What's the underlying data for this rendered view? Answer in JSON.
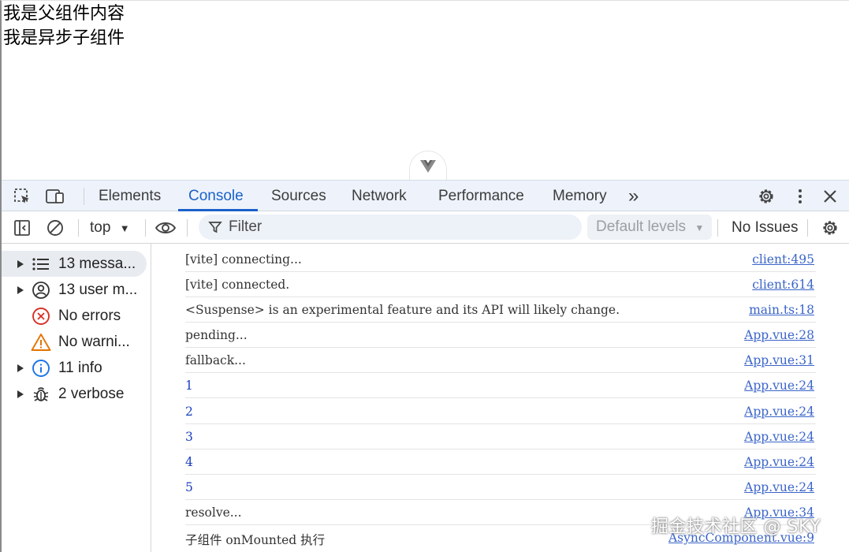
{
  "page": {
    "lines": [
      "我是父组件内容",
      "我是异步子组件"
    ]
  },
  "devtools": {
    "tabs": [
      "Elements",
      "Console",
      "Sources",
      "Network",
      "Performance",
      "Memory"
    ],
    "more_tabs": "»",
    "toolbar": {
      "context": "top",
      "filter_placeholder": "Filter",
      "levels": "Default levels",
      "issues": "No Issues"
    },
    "sidebar": [
      {
        "label": "13 messa...",
        "icon": "list-icon",
        "expandable": true,
        "selected": true
      },
      {
        "label": "13 user m...",
        "icon": "user-icon",
        "expandable": true,
        "selected": false
      },
      {
        "label": "No errors",
        "icon": "error-icon",
        "expandable": false,
        "selected": false
      },
      {
        "label": "No warni...",
        "icon": "warning-icon",
        "expandable": false,
        "selected": false
      },
      {
        "label": "11 info",
        "icon": "info-icon",
        "expandable": true,
        "selected": false
      },
      {
        "label": "2 verbose",
        "icon": "bug-icon",
        "expandable": true,
        "selected": false
      }
    ],
    "console_rows": [
      {
        "msg": "[vite] connecting...",
        "src": "client:495"
      },
      {
        "msg": "[vite] connected.",
        "src": "client:614"
      },
      {
        "msg": "<Suspense> is an experimental feature and its API will likely change.",
        "src": "main.ts:18"
      },
      {
        "msg": "pending...",
        "src": "App.vue:28"
      },
      {
        "msg": "fallback...",
        "src": "App.vue:31"
      },
      {
        "msg": "1",
        "src": "App.vue:24"
      },
      {
        "msg": "2",
        "src": "App.vue:24"
      },
      {
        "msg": "3",
        "src": "App.vue:24"
      },
      {
        "msg": "4",
        "src": "App.vue:24"
      },
      {
        "msg": "5",
        "src": "App.vue:24"
      },
      {
        "msg": "resolve...",
        "src": "App.vue:34"
      },
      {
        "msg": "子组件 onMounted 执行",
        "src": "AsyncComponent.vue:9"
      }
    ]
  },
  "watermark": "掘金技术社区 @ SKY",
  "colors": {
    "accent": "#1a61c9",
    "link": "#3a64c9",
    "error": "#d93025",
    "warning": "#e37400",
    "info": "#1a73e8"
  }
}
